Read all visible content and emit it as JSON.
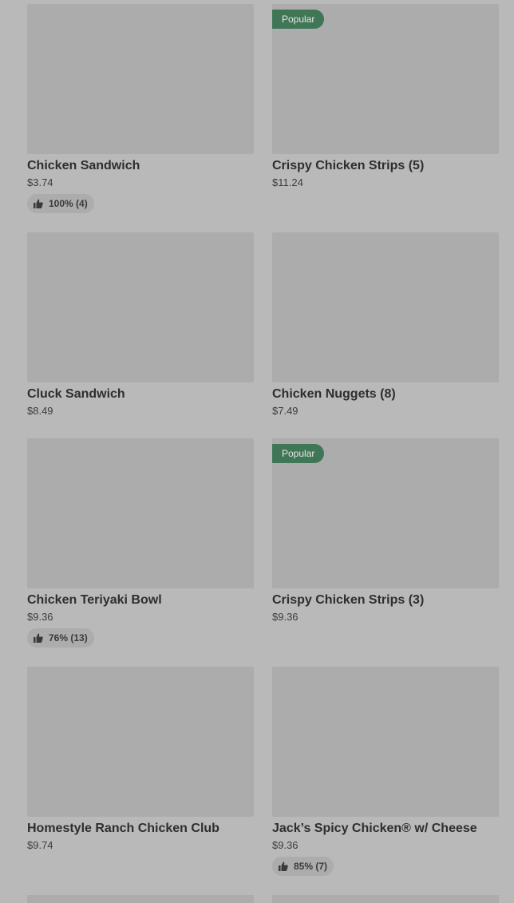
{
  "items": [
    {
      "name": "Chicken Sandwich",
      "price": "$3.74",
      "badge": "",
      "rating": "100% (4)"
    },
    {
      "name": "Crispy Chicken Strips (5)",
      "price": "$11.24",
      "badge": "Popular",
      "rating": ""
    },
    {
      "name": "Cluck Sandwich",
      "price": "$8.49",
      "badge": "",
      "rating": ""
    },
    {
      "name": "Chicken Nuggets (8)",
      "price": "$7.49",
      "badge": "",
      "rating": ""
    },
    {
      "name": "Chicken Teriyaki Bowl",
      "price": "$9.36",
      "badge": "",
      "rating": "76% (13)"
    },
    {
      "name": "Crispy Chicken Strips (3)",
      "price": "$9.36",
      "badge": "Popular",
      "rating": ""
    },
    {
      "name": "Homestyle Ranch Chicken Club",
      "price": "$9.74",
      "badge": "",
      "rating": ""
    },
    {
      "name": "Jack’s Spicy Chicken® w/ Cheese",
      "price": "$9.36",
      "badge": "",
      "rating": "85% (7)"
    }
  ],
  "icons": {
    "rating": "thumbs-up-icon"
  },
  "colors": {
    "badge": "#3f7656",
    "background": "#b9b9b9",
    "placeholder": "#acacac"
  }
}
